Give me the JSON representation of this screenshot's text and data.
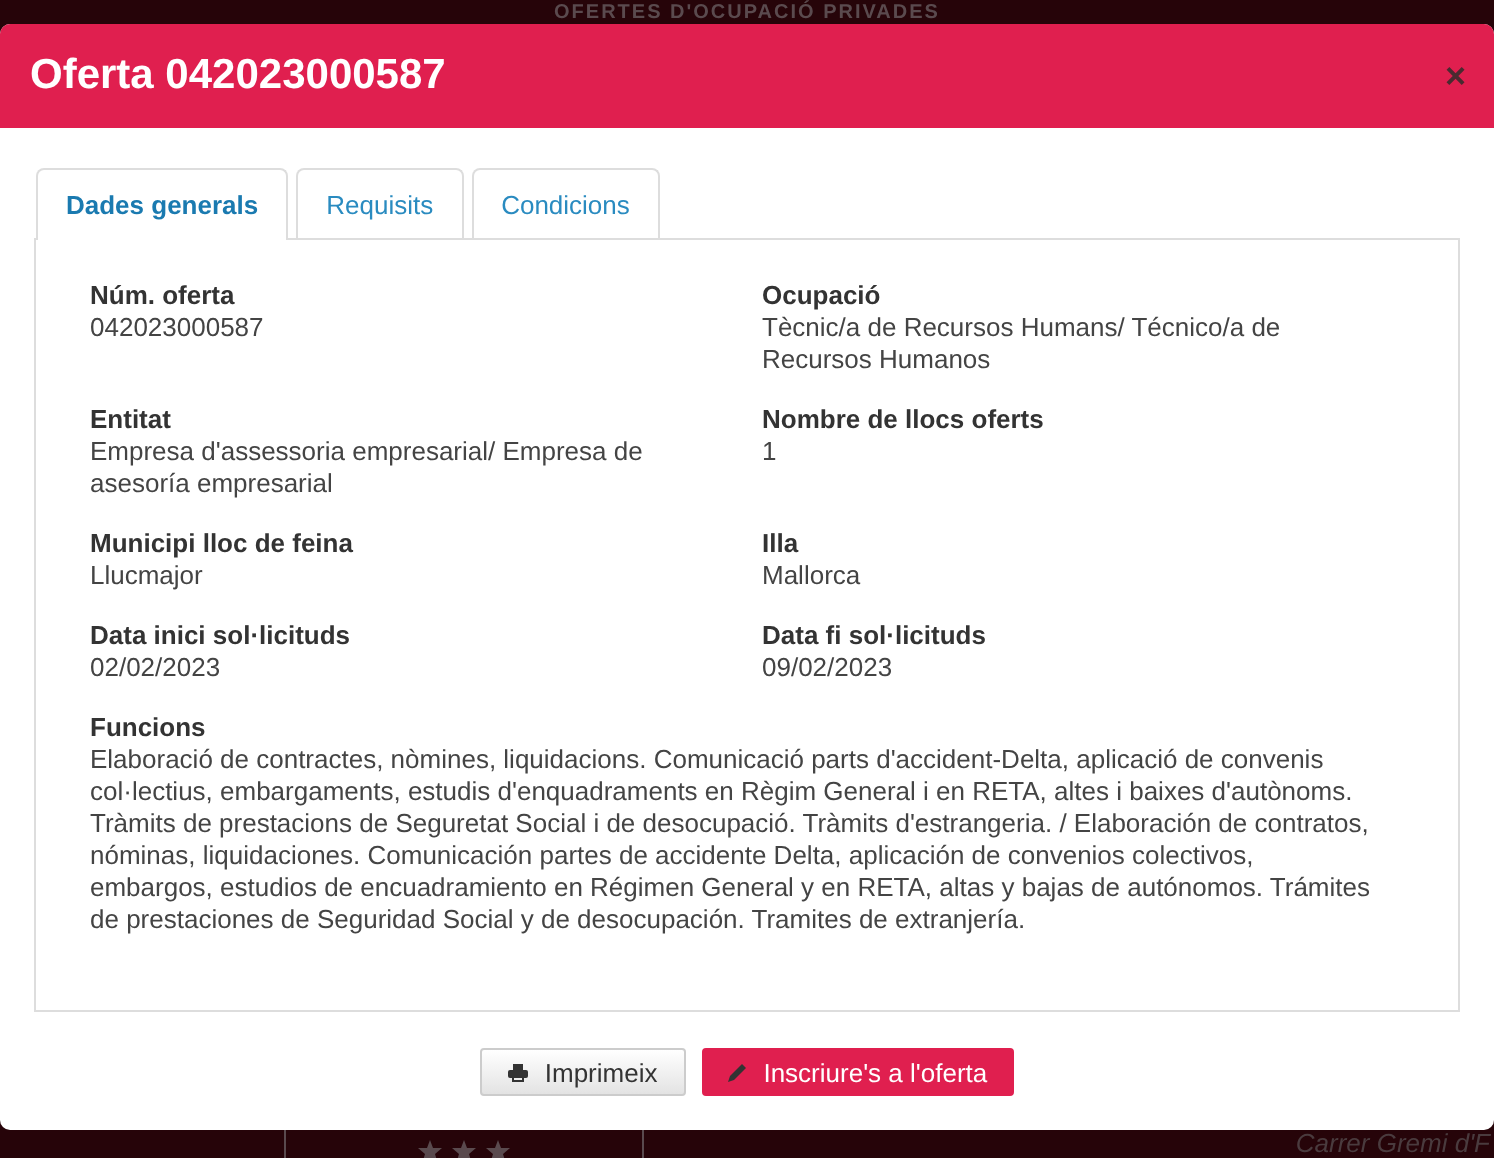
{
  "background": {
    "heading": "OFERTES D'OCUPACIÓ PRIVADES",
    "address": "Carrer Gremi d'F"
  },
  "dialog": {
    "title": "Oferta 042023000587",
    "close": "×"
  },
  "tabs": [
    {
      "label": "Dades generals",
      "selected": true
    },
    {
      "label": "Requisits",
      "selected": false
    },
    {
      "label": "Condicions",
      "selected": false
    }
  ],
  "fields": [
    {
      "label": "Núm. oferta",
      "value": "042023000587"
    },
    {
      "label": "Ocupació",
      "value": "Tècnic/a de Recursos Humans/ Técnico/a de Recursos Humanos"
    },
    {
      "label": "Entitat",
      "value": "Empresa d'assessoria empresarial/ Empresa de asesoría empresarial"
    },
    {
      "label": "Nombre de llocs oferts",
      "value": "1"
    },
    {
      "label": "Municipi lloc de feina",
      "value": "Llucmajor"
    },
    {
      "label": "Illa",
      "value": "Mallorca"
    },
    {
      "label": "Data inici sol·licituds",
      "value": "02/02/2023"
    },
    {
      "label": "Data fi sol·licituds",
      "value": "09/02/2023"
    }
  ],
  "funcions": {
    "label": "Funcions",
    "value": "Elaboració de contractes, nòmines, liquidacions. Comunicació parts d'accident-Delta, aplicació de convenis col·lectius, embargaments, estudis d'enquadraments en Règim General i en RETA, altes i baixes d'autònoms. Tràmits de prestacions de Seguretat Social i de desocupació. Tràmits d'estrangeria. / Elaboración de contratos, nóminas, liquidaciones. Comunicación partes de accidente Delta, aplicación de convenios colectivos, embargos, estudios de encuadramiento en Régimen General y en RETA, altas y bajas de autónomos. Trámites de prestaciones de Seguridad Social y de desocupación. Tramites de extranjería."
  },
  "buttons": [
    {
      "label": "Imprimeix",
      "kind": "print"
    },
    {
      "label": "Inscriure's a l'oferta",
      "kind": "apply"
    }
  ]
}
